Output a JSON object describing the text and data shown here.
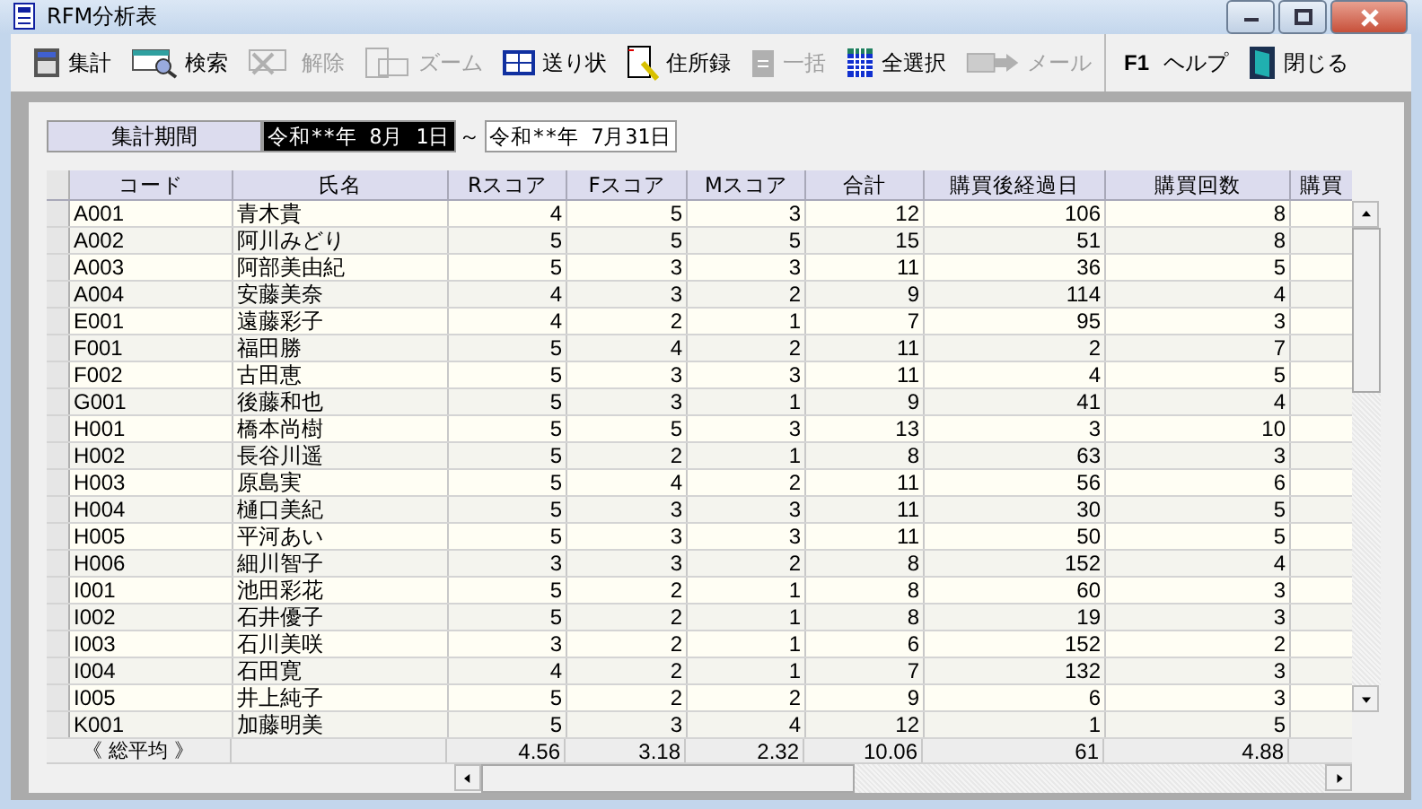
{
  "window": {
    "title": "RFM分析表"
  },
  "toolbar": [
    {
      "label": "集計",
      "kind": "calc",
      "disabled": false
    },
    {
      "label": "検索",
      "kind": "search",
      "disabled": false
    },
    {
      "label": "解除",
      "kind": "clear",
      "disabled": true
    },
    {
      "label": "ズーム",
      "kind": "zoom",
      "disabled": true
    },
    {
      "label": "送り状",
      "kind": "invoice",
      "disabled": false
    },
    {
      "label": "住所録",
      "kind": "address",
      "disabled": false
    },
    {
      "label": "一括",
      "kind": "batch",
      "disabled": true
    },
    {
      "label": "全選択",
      "kind": "selectall",
      "disabled": false
    },
    {
      "label": "メール",
      "kind": "mail",
      "disabled": true
    },
    {
      "label": "ヘルプ",
      "kind": "help",
      "key": "F1",
      "disabled": false
    },
    {
      "label": "閉じる",
      "kind": "close",
      "disabled": false
    }
  ],
  "period": {
    "label": "集計期間",
    "from": {
      "value": "令和**年 8月 1日",
      "selected": true
    },
    "separator": "～",
    "to": {
      "value": "令和**年 7月31日",
      "selected": false
    }
  },
  "table": {
    "columns": [
      "コード",
      "氏名",
      "Rスコア",
      "Fスコア",
      "Mスコア",
      "合計",
      "購買後経過日",
      "購買回数",
      "購買"
    ],
    "rows": [
      [
        "A001",
        "青木貴",
        "4",
        "5",
        "3",
        "12",
        "106",
        "8"
      ],
      [
        "A002",
        "阿川みどり",
        "5",
        "5",
        "5",
        "15",
        "51",
        "8"
      ],
      [
        "A003",
        "阿部美由紀",
        "5",
        "3",
        "3",
        "11",
        "36",
        "5"
      ],
      [
        "A004",
        "安藤美奈",
        "4",
        "3",
        "2",
        "9",
        "114",
        "4"
      ],
      [
        "E001",
        "遠藤彩子",
        "4",
        "2",
        "1",
        "7",
        "95",
        "3"
      ],
      [
        "F001",
        "福田勝",
        "5",
        "4",
        "2",
        "11",
        "2",
        "7"
      ],
      [
        "F002",
        "古田恵",
        "5",
        "3",
        "3",
        "11",
        "4",
        "5"
      ],
      [
        "G001",
        "後藤和也",
        "5",
        "3",
        "1",
        "9",
        "41",
        "4"
      ],
      [
        "H001",
        "橋本尚樹",
        "5",
        "5",
        "3",
        "13",
        "3",
        "10"
      ],
      [
        "H002",
        "長谷川遥",
        "5",
        "2",
        "1",
        "8",
        "63",
        "3"
      ],
      [
        "H003",
        "原島実",
        "5",
        "4",
        "2",
        "11",
        "56",
        "6"
      ],
      [
        "H004",
        "樋口美紀",
        "5",
        "3",
        "3",
        "11",
        "30",
        "5"
      ],
      [
        "H005",
        "平河あい",
        "5",
        "3",
        "3",
        "11",
        "50",
        "5"
      ],
      [
        "H006",
        "細川智子",
        "3",
        "3",
        "2",
        "8",
        "152",
        "4"
      ],
      [
        "I001",
        "池田彩花",
        "5",
        "2",
        "1",
        "8",
        "60",
        "3"
      ],
      [
        "I002",
        "石井優子",
        "5",
        "2",
        "1",
        "8",
        "19",
        "3"
      ],
      [
        "I003",
        "石川美咲",
        "3",
        "2",
        "1",
        "6",
        "152",
        "2"
      ],
      [
        "I004",
        "石田寛",
        "4",
        "2",
        "1",
        "7",
        "132",
        "3"
      ],
      [
        "I005",
        "井上純子",
        "5",
        "2",
        "2",
        "9",
        "6",
        "3"
      ],
      [
        "K001",
        "加藤明美",
        "5",
        "3",
        "4",
        "12",
        "1",
        "5"
      ]
    ],
    "footer": {
      "label": "《 総平均 》",
      "values": [
        "4.56",
        "3.18",
        "2.32",
        "10.06",
        "61",
        "4.88"
      ]
    }
  }
}
